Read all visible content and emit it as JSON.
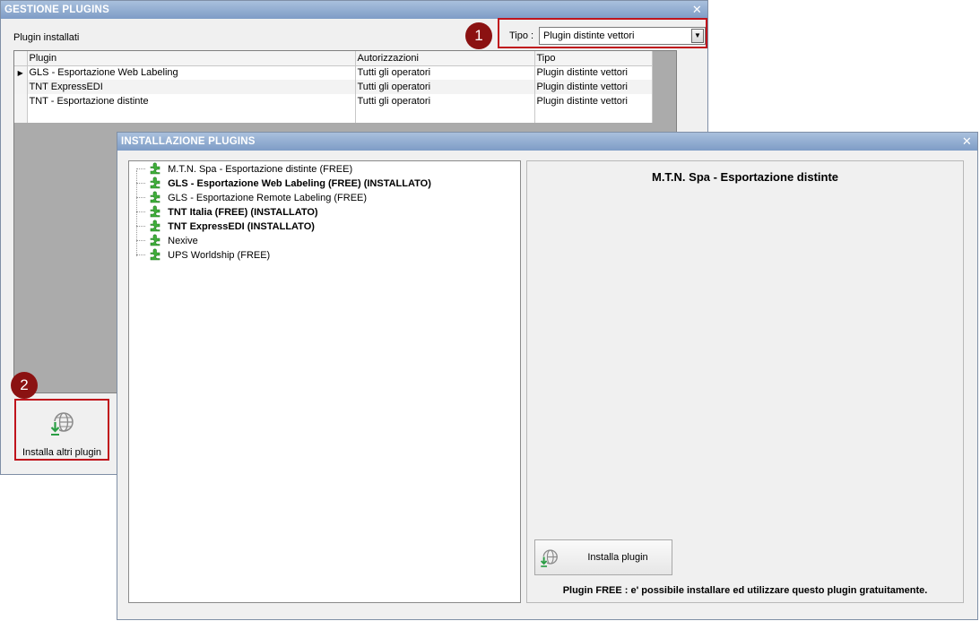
{
  "gestione": {
    "title": "GESTIONE PLUGINS",
    "subtitle": "Plugin installati",
    "filter": {
      "label": "Tipo :",
      "value": "Plugin distinte vettori"
    },
    "badge": "1",
    "columns": [
      "Plugin",
      "Autorizzazioni",
      "Tipo"
    ],
    "rows": [
      {
        "plugin": "GLS - Esportazione Web Labeling",
        "auth": "Tutti gli operatori",
        "tipo": "Plugin distinte vettori"
      },
      {
        "plugin": "TNT ExpressEDI",
        "auth": "Tutti gli operatori",
        "tipo": "Plugin distinte vettori"
      },
      {
        "plugin": "TNT - Esportazione distinte",
        "auth": "Tutti gli operatori",
        "tipo": "Plugin distinte vettori"
      }
    ],
    "install_more": {
      "badge": "2",
      "label": "Installa altri plugin"
    }
  },
  "installazione": {
    "title": "INSTALLAZIONE PLUGINS",
    "tree": [
      {
        "label": "M.T.N. Spa - Esportazione distinte (FREE)",
        "bold": false
      },
      {
        "label": "GLS - Esportazione Web Labeling (FREE) (INSTALLATO)",
        "bold": true
      },
      {
        "label": "GLS - Esportazione Remote Labeling (FREE)",
        "bold": false
      },
      {
        "label": "TNT Italia (FREE) (INSTALLATO)",
        "bold": true
      },
      {
        "label": "TNT ExpressEDI (INSTALLATO)",
        "bold": true
      },
      {
        "label": "Nexive",
        "bold": false
      },
      {
        "label": "UPS Worldship (FREE)",
        "bold": false
      }
    ],
    "detail": {
      "title": "M.T.N. Spa - Esportazione distinte",
      "install_label": "Installa plugin",
      "note": "Plugin FREE : e' possibile installare ed utilizzare questo plugin gratuitamente."
    }
  },
  "colors": {
    "titlebar": "#7e9cc6",
    "highlight": "#c0141c",
    "badge": "#8b1212",
    "plugin_icon": "#3fae3a",
    "install_arrow": "#2a9d44"
  },
  "icons": {
    "close": "close-icon",
    "plugin": "puzzle-icon",
    "install": "globe-download-icon",
    "row_pointer": "row-pointer-icon",
    "dropdown": "chevron-down-icon"
  }
}
